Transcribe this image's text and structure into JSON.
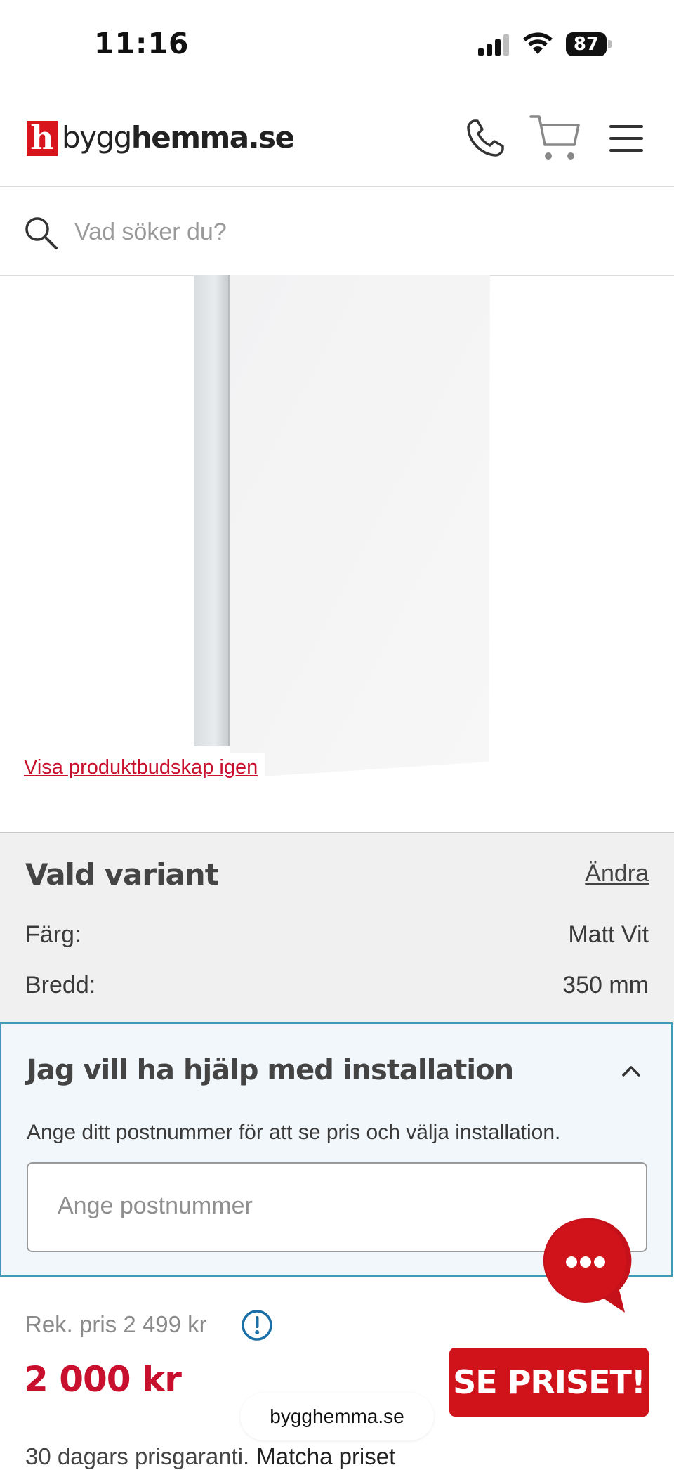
{
  "status_bar": {
    "time": "11:16",
    "battery": "87"
  },
  "header": {
    "logo_letter": "h",
    "logo_text_regular": "bygg",
    "logo_text_bold": "hemma.se"
  },
  "search": {
    "placeholder": "Vad söker du?"
  },
  "product": {
    "promo_link": "Visa produktbudskap igen"
  },
  "variant": {
    "title": "Vald variant",
    "change_label": "Ändra",
    "specs": [
      {
        "label": "Färg:",
        "value": "Matt Vit"
      },
      {
        "label": "Bredd:",
        "value": "350 mm"
      }
    ]
  },
  "installation": {
    "title": "Jag vill ha hjälp med installation",
    "description": "Ange ditt postnummer för att se pris och välja installation.",
    "postcode_placeholder": "Ange postnummer"
  },
  "pricing": {
    "recommended": "Rek. pris 2 499 kr",
    "price": "2 000 kr",
    "cta": "SE PRISET!",
    "guarantee": "30 dagars prisgaranti.",
    "match_link": "Matcha priset"
  },
  "browser": {
    "url": "bygghemma.se"
  },
  "colors": {
    "brand_red": "#d8141c",
    "accent_blue": "#3f9ab6"
  }
}
